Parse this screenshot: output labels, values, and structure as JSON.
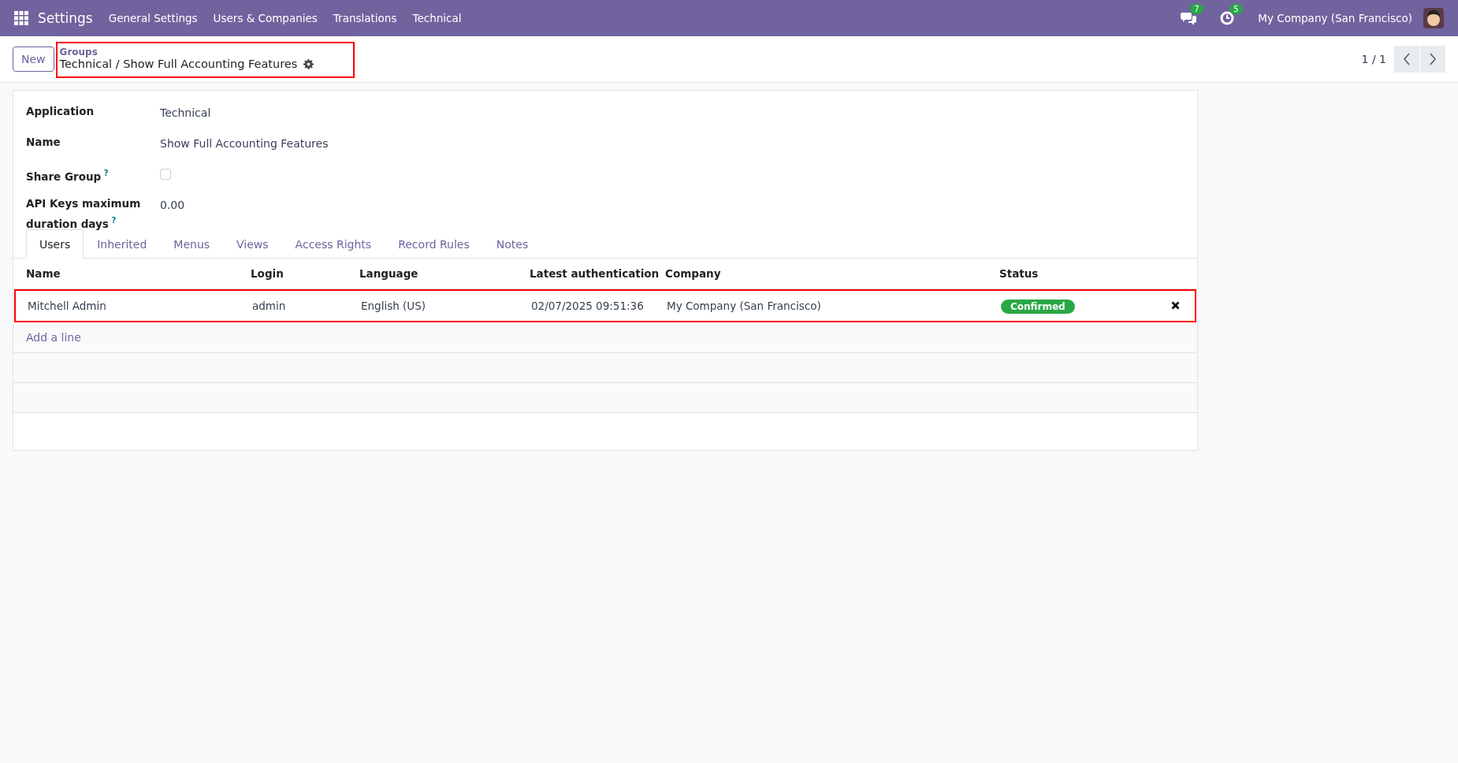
{
  "navbar": {
    "app": "Settings",
    "menu": [
      "General Settings",
      "Users & Companies",
      "Translations",
      "Technical"
    ],
    "messages_count": "7",
    "activities_count": "5",
    "company": "My Company (San Francisco)"
  },
  "control_panel": {
    "new_button": "New",
    "breadcrumb_parent": "Groups",
    "breadcrumb_current": "Technical / Show Full Accounting Features",
    "highlighted": true,
    "pager": "1 / 1"
  },
  "form": {
    "fields": [
      {
        "label": "Application",
        "value": "Technical",
        "kind": "text",
        "help": false
      },
      {
        "label": "Name",
        "value": "Show Full Accounting Features",
        "kind": "text",
        "help": false
      },
      {
        "label": "Share Group",
        "kind": "checkbox",
        "checked": false,
        "help": true
      },
      {
        "label": "API Keys maximum duration days",
        "value": "0.00",
        "kind": "text",
        "help": true
      }
    ],
    "help_mark": "?",
    "tabs": [
      {
        "label": "Users",
        "selected": true
      },
      {
        "label": "Inherited",
        "selected": false
      },
      {
        "label": "Menus",
        "selected": false
      },
      {
        "label": "Views",
        "selected": false
      },
      {
        "label": "Access Rights",
        "selected": false
      },
      {
        "label": "Record Rules",
        "selected": false
      },
      {
        "label": "Notes",
        "selected": false
      }
    ],
    "table": {
      "columns": [
        "Name",
        "Login",
        "Language",
        "Latest authentication",
        "Company",
        "Status"
      ],
      "rows": [
        {
          "cells": [
            "Mitchell Admin",
            "admin",
            "English (US)",
            "02/07/2025 09:51:36",
            "My Company (San Francisco)"
          ],
          "status": "Confirmed",
          "highlighted": true
        }
      ],
      "add_line": "Add a line"
    }
  }
}
